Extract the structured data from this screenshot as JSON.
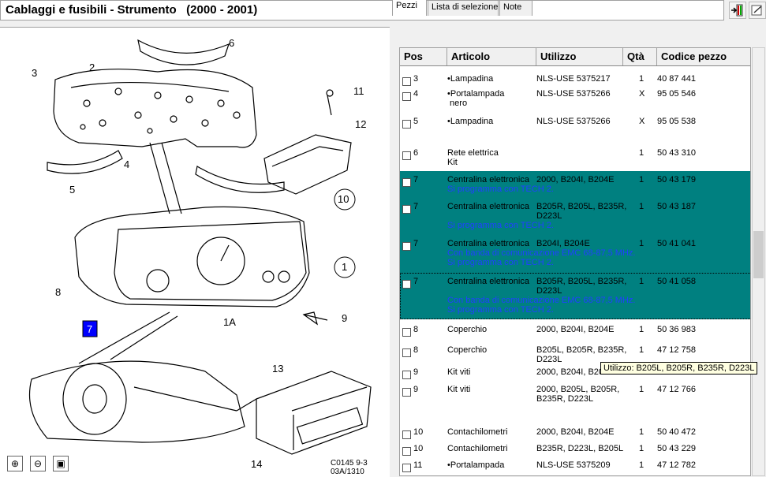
{
  "title": "Cablaggi e fusibili - Strumento   (2000 - 2001)",
  "toolbar": {
    "btn1_icon": "exit-icon",
    "btn2_icon": "notes-icon"
  },
  "diagram": {
    "callouts": [
      "1",
      "1A",
      "2",
      "3",
      "4",
      "5",
      "6",
      "7",
      "8",
      "9",
      "10",
      "11",
      "12",
      "13",
      "14"
    ],
    "code_line1": "C0145 9-3",
    "code_line2": "03A/1310"
  },
  "zoom": {
    "in_icon": "zoom-in-icon",
    "out_icon": "zoom-out-icon",
    "fit_icon": "fit-icon"
  },
  "tabs": [
    "Pezzi",
    "Lista di selezione",
    "Note"
  ],
  "columns": [
    "Pos",
    "Articolo",
    "Utilizzo",
    "Qtà",
    "Codice pezzo"
  ],
  "rows": [
    {
      "pos": "3",
      "art": "•Lampadina",
      "uso": "NLS-USE 5375217",
      "qty": "1",
      "code": "40 87 441",
      "note": "",
      "sel": false
    },
    {
      "pos": "4",
      "art": "•Portalampada\n nero",
      "uso": "NLS-USE 5375266",
      "qty": "X",
      "code": "95 05 546",
      "note": "",
      "sel": false
    },
    {
      "pos": "5",
      "art": "•Lampadina",
      "uso": "NLS-USE 5375266",
      "qty": "X",
      "code": "95 05 538",
      "note": "",
      "sel": false
    },
    {
      "pos": "6",
      "art": "Rete elettrica\nKit",
      "uso": "",
      "qty": "1",
      "code": "50 43 310",
      "note": "",
      "sel": false
    },
    {
      "pos": "7",
      "art": "Centralina elettronica",
      "uso": "2000, B204I, B204E",
      "qty": "1",
      "code": "50 43 179",
      "note": "Si programma con TECH 2.",
      "sel": true
    },
    {
      "pos": "7",
      "art": "Centralina elettronica",
      "uso": "B205R, B205L, B235R,\nD223L",
      "qty": "1",
      "code": "50 43 187",
      "note": "Si programma con TECH 2.",
      "sel": true
    },
    {
      "pos": "7",
      "art": "Centralina elettronica",
      "uso": "B204I, B204E",
      "qty": "1",
      "code": "50 41 041",
      "note": "Con banda di comunicazione EMC 68-87,5 MHz.\nSi programma con TECH 2.",
      "sel": true
    },
    {
      "pos": "7",
      "art": "Centralina elettronica",
      "uso": "B205R, B205L, B235R,\nD223L",
      "qty": "1",
      "code": "50 41 058",
      "note": "Con banda di comunicazione EMC 68-87,5 MHz.\nSi programma con TECH 2.",
      "sel": true
    },
    {
      "pos": "8",
      "art": "Coperchio",
      "uso": "2000, B204I, B204E",
      "qty": "1",
      "code": "50 36 983",
      "note": "",
      "sel": false
    },
    {
      "pos": "8",
      "art": "Coperchio",
      "uso": "B205L, B205R, B235R,\nD223L",
      "qty": "1",
      "code": "47 12 758",
      "note": "",
      "sel": false
    },
    {
      "pos": "9",
      "art": "Kit viti",
      "uso": "2000, B204I, B20",
      "qty": "",
      "code": "",
      "note": "",
      "sel": false
    },
    {
      "pos": "9",
      "art": "Kit viti",
      "uso": "2000, B205L, B205R,\nB235R, D223L",
      "qty": "1",
      "code": "47 12 766",
      "note": "",
      "sel": false
    },
    {
      "pos": "10",
      "art": "Contachilometri",
      "uso": "2000, B204I, B204E",
      "qty": "1",
      "code": "50 40 472",
      "note": "",
      "sel": false
    },
    {
      "pos": "10",
      "art": "Contachilometri",
      "uso": "B235R, D223L, B205L",
      "qty": "1",
      "code": "50 43 229",
      "note": "",
      "sel": false
    },
    {
      "pos": "11",
      "art": "•Portalampada",
      "uso": "NLS-USE 5375209",
      "qty": "1",
      "code": "47 12 782",
      "note": "",
      "sel": false
    }
  ],
  "tooltip": "Utilizzo: B205L, B205R, B235R, D223L"
}
